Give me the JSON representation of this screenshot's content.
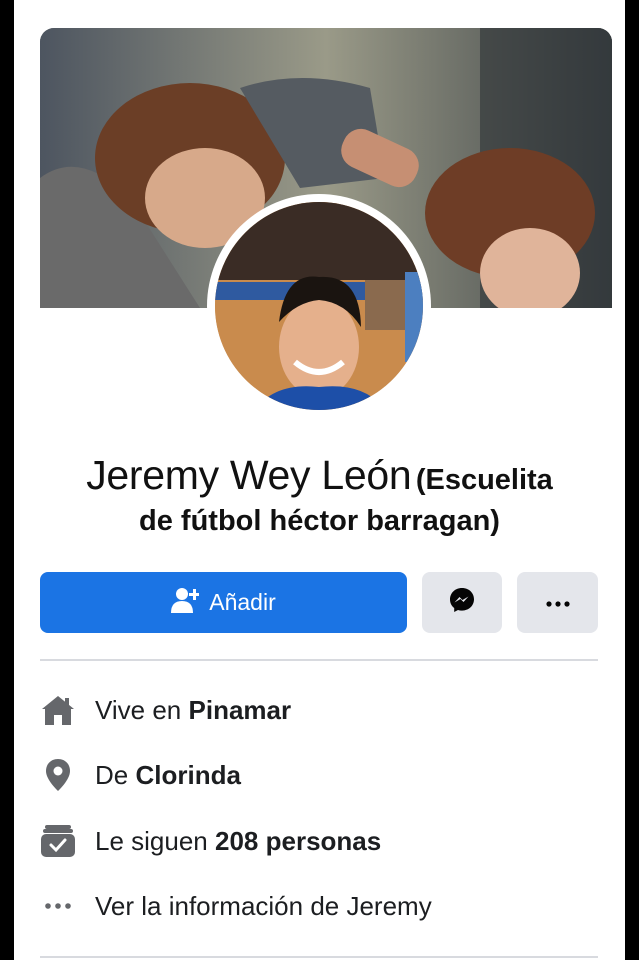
{
  "profile": {
    "name": "Jeremy Wey León",
    "alternate_name_line1": "(Escuelita",
    "alternate_name_line2": "de fútbol héctor barragan)"
  },
  "actions": {
    "add_label": "Añadir",
    "add_icon": "add-friend-icon",
    "message_icon": "messenger-icon",
    "more_icon": "more-dots-icon"
  },
  "info": {
    "lives": {
      "prefix": "Vive en",
      "value": "Pinamar",
      "icon": "home-icon"
    },
    "from": {
      "prefix": "De",
      "value": "Clorinda",
      "icon": "location-pin-icon"
    },
    "followers": {
      "prefix": "Le siguen",
      "value": "208 personas",
      "icon": "followers-icon"
    },
    "see_info": {
      "text": "Ver la información de Jeremy",
      "icon": "more-dots-icon"
    }
  },
  "colors": {
    "accent": "#1b74e4",
    "icon_gray": "#65676b",
    "secondary_button": "#e4e6eb"
  }
}
